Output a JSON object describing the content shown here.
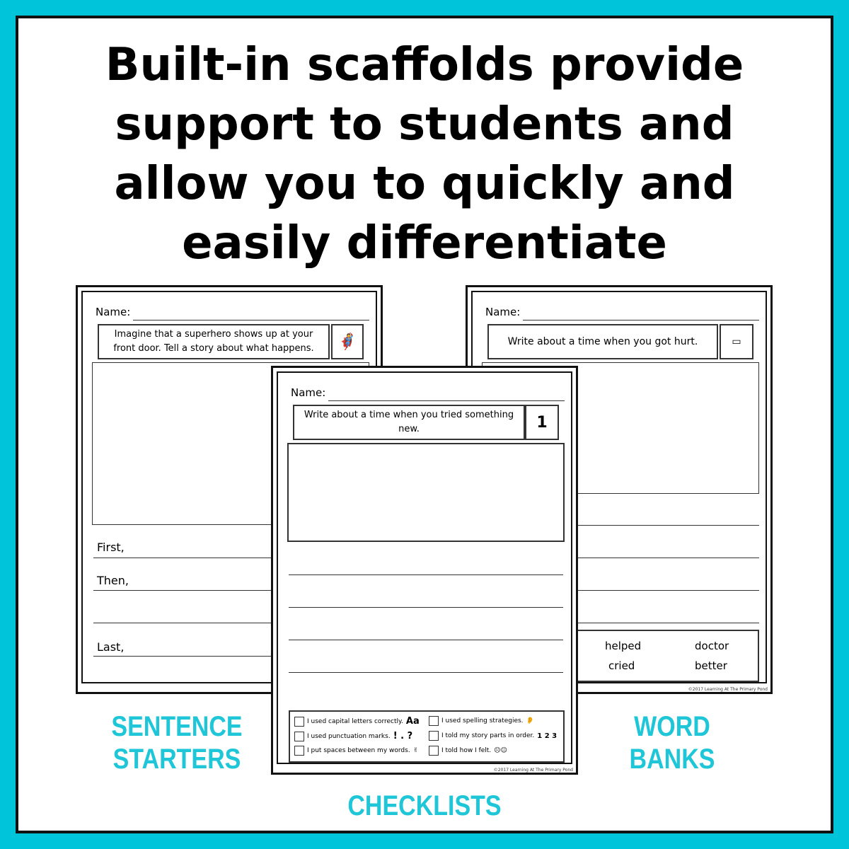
{
  "headline": [
    "Built-in scaffolds provide",
    "support to students and",
    "allow you to quickly and",
    "easily differentiate"
  ],
  "colors": {
    "frame": "#00c4da",
    "label": "#1ec6d8"
  },
  "left_sheet": {
    "name_label": "Name:",
    "prompt": "Imagine that a superhero shows up at your front door. Tell a story about what happens.",
    "icon": "superhero-icon",
    "starters": [
      "First,",
      "Then,",
      "Last,"
    ]
  },
  "right_sheet": {
    "name_label": "Name:",
    "prompt": "Write about a time when you got hurt.",
    "icon": "bandage-icon",
    "word_bank": [
      "helped",
      "doctor",
      "cried",
      "better"
    ],
    "copyright": "©2017 Learning At The Primary Pond"
  },
  "center_sheet": {
    "name_label": "Name:",
    "prompt": "Write about a time when you tried something new.",
    "number": "1",
    "checklist": [
      {
        "text": "I used capital letters correctly.",
        "symbol": "Aa"
      },
      {
        "text": "I used spelling strategies.",
        "symbol": "👂"
      },
      {
        "text": "I used punctuation marks.",
        "symbol": "! . ?"
      },
      {
        "text": "I told my story parts in order.",
        "symbol": "1 2 3"
      },
      {
        "text": "I put spaces between my words.",
        "symbol": "✌"
      },
      {
        "text": "I told how I felt.",
        "symbol": "☹☺"
      }
    ],
    "copyright": "©2017 Learning At The Primary Pond"
  },
  "labels": {
    "left": "SENTENCE STARTERS",
    "right": "WORD BANKS",
    "center": "CHECKLISTS"
  }
}
